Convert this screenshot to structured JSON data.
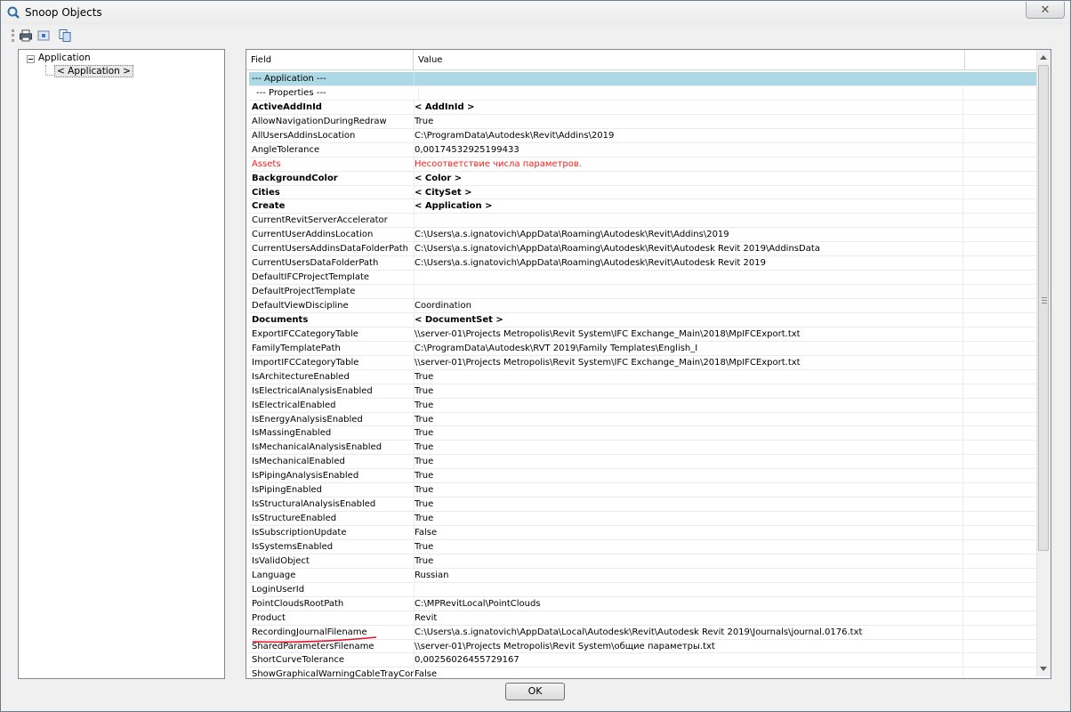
{
  "window": {
    "title": "Snoop Objects",
    "close_glyph": "✕"
  },
  "toolbar": {
    "icons": [
      "print-icon",
      "snoop-icon",
      "copy-icon"
    ]
  },
  "tree": {
    "root_label": "Application",
    "child_label": "< Application >"
  },
  "grid": {
    "columns": [
      "Field",
      "Value"
    ],
    "rows": [
      {
        "field": "--- Application ---",
        "value": "",
        "kind": "section"
      },
      {
        "field": "--- Properties ---",
        "value": "",
        "kind": "sub"
      },
      {
        "field": "ActiveAddInId",
        "value": "< AddInId >",
        "kind": "bold"
      },
      {
        "field": "AllowNavigationDuringRedraw",
        "value": "True",
        "kind": ""
      },
      {
        "field": "AllUsersAddinsLocation",
        "value": "C:\\ProgramData\\Autodesk\\Revit\\Addins\\2019",
        "kind": ""
      },
      {
        "field": "AngleTolerance",
        "value": "0,00174532925199433",
        "kind": ""
      },
      {
        "field": "Assets",
        "value": "Несоответствие числа параметров.",
        "kind": "error"
      },
      {
        "field": "BackgroundColor",
        "value": "< Color >",
        "kind": "bold"
      },
      {
        "field": "Cities",
        "value": "< CitySet >",
        "kind": "bold"
      },
      {
        "field": "Create",
        "value": "< Application >",
        "kind": "bold"
      },
      {
        "field": "CurrentRevitServerAccelerator",
        "value": "",
        "kind": ""
      },
      {
        "field": "CurrentUserAddinsLocation",
        "value": "C:\\Users\\a.s.ignatovich\\AppData\\Roaming\\Autodesk\\Revit\\Addins\\2019",
        "kind": ""
      },
      {
        "field": "CurrentUsersAddinsDataFolderPath",
        "value": "C:\\Users\\a.s.ignatovich\\AppData\\Roaming\\Autodesk\\Revit\\Autodesk Revit 2019\\AddinsData",
        "kind": ""
      },
      {
        "field": "CurrentUsersDataFolderPath",
        "value": "C:\\Users\\a.s.ignatovich\\AppData\\Roaming\\Autodesk\\Revit\\Autodesk Revit 2019",
        "kind": ""
      },
      {
        "field": "DefaultIFCProjectTemplate",
        "value": "",
        "kind": ""
      },
      {
        "field": "DefaultProjectTemplate",
        "value": "",
        "kind": ""
      },
      {
        "field": "DefaultViewDiscipline",
        "value": "Coordination",
        "kind": ""
      },
      {
        "field": "Documents",
        "value": "< DocumentSet >",
        "kind": "bold"
      },
      {
        "field": "ExportIFCCategoryTable",
        "value": "\\\\server-01\\Projects Metropolis\\Revit System\\IFC Exchange_Main\\2018\\MpIFCExport.txt",
        "kind": ""
      },
      {
        "field": "FamilyTemplatePath",
        "value": "C:\\ProgramData\\Autodesk\\RVT 2019\\Family Templates\\English_I",
        "kind": ""
      },
      {
        "field": "ImportIFCCategoryTable",
        "value": "\\\\server-01\\Projects Metropolis\\Revit System\\IFC Exchange_Main\\2018\\MpIFCExport.txt",
        "kind": ""
      },
      {
        "field": "IsArchitectureEnabled",
        "value": "True",
        "kind": ""
      },
      {
        "field": "IsElectricalAnalysisEnabled",
        "value": "True",
        "kind": ""
      },
      {
        "field": "IsElectricalEnabled",
        "value": "True",
        "kind": ""
      },
      {
        "field": "IsEnergyAnalysisEnabled",
        "value": "True",
        "kind": ""
      },
      {
        "field": "IsMassingEnabled",
        "value": "True",
        "kind": ""
      },
      {
        "field": "IsMechanicalAnalysisEnabled",
        "value": "True",
        "kind": ""
      },
      {
        "field": "IsMechanicalEnabled",
        "value": "True",
        "kind": ""
      },
      {
        "field": "IsPipingAnalysisEnabled",
        "value": "True",
        "kind": ""
      },
      {
        "field": "IsPipingEnabled",
        "value": "True",
        "kind": ""
      },
      {
        "field": "IsStructuralAnalysisEnabled",
        "value": "True",
        "kind": ""
      },
      {
        "field": "IsStructureEnabled",
        "value": "True",
        "kind": ""
      },
      {
        "field": "IsSubscriptionUpdate",
        "value": "False",
        "kind": ""
      },
      {
        "field": "IsSystemsEnabled",
        "value": "True",
        "kind": ""
      },
      {
        "field": "IsValidObject",
        "value": "True",
        "kind": ""
      },
      {
        "field": "Language",
        "value": "Russian",
        "kind": ""
      },
      {
        "field": "LoginUserId",
        "value": "",
        "kind": ""
      },
      {
        "field": "PointCloudsRootPath",
        "value": "C:\\MPRevitLocal\\PointClouds",
        "kind": ""
      },
      {
        "field": "Product",
        "value": "Revit",
        "kind": ""
      },
      {
        "field": "RecordingJournalFilename",
        "value": "C:\\Users\\a.s.ignatovich\\AppData\\Local\\Autodesk\\Revit\\Autodesk Revit 2019\\Journals\\journal.0176.txt",
        "kind": ""
      },
      {
        "field": "SharedParametersFilename",
        "value": "\\\\server-01\\Projects Metropolis\\Revit System\\общие параметры.txt",
        "kind": ""
      },
      {
        "field": "ShortCurveTolerance",
        "value": "0,00256026455729167",
        "kind": ""
      },
      {
        "field": "ShowGraphicalWarningCableTrayCon",
        "value": "False",
        "kind": ""
      }
    ]
  },
  "footer": {
    "ok_label": "OK"
  },
  "colors": {
    "section_bg": "#add8e6",
    "error_text": "#ff1a1a",
    "annotation_stroke": "#e8102a"
  }
}
